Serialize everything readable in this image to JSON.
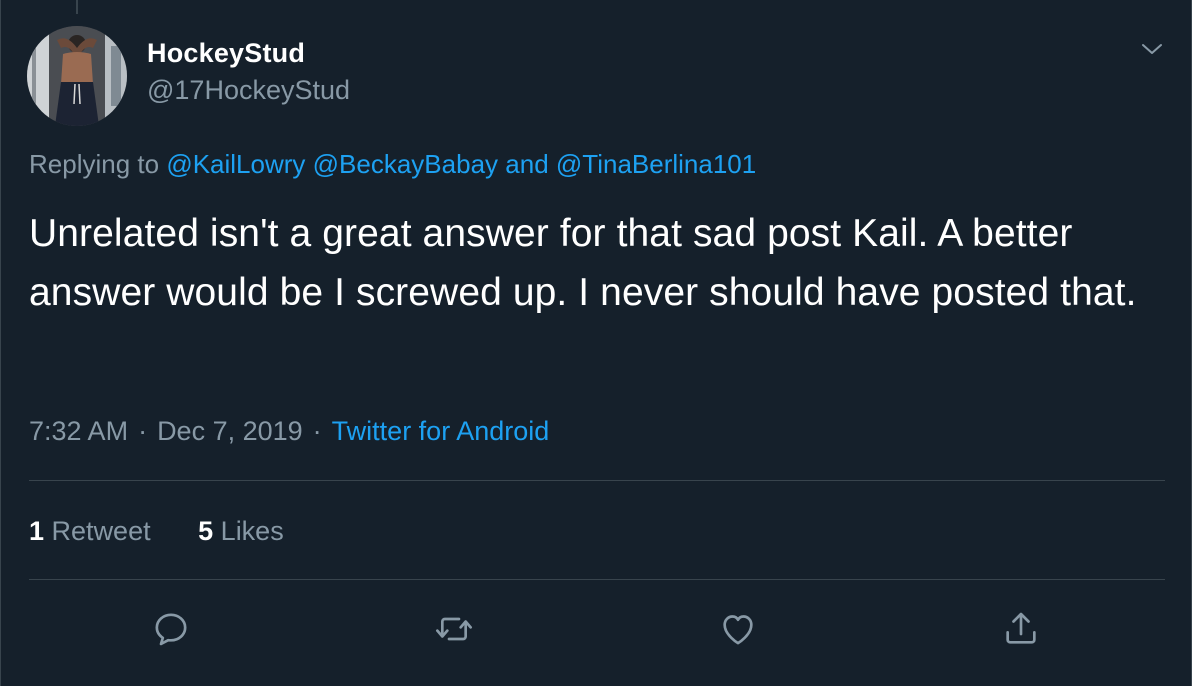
{
  "author": {
    "display_name": "HockeyStud",
    "handle": "@17HockeyStud"
  },
  "reply": {
    "prefix": "Replying to",
    "mention_1": "@KailLowry",
    "mention_2": "@BeckayBabay",
    "conjunction": "and",
    "mention_3": "@TinaBerlina101"
  },
  "tweet": {
    "text": "Unrelated isn't a great answer for that sad post Kail. A better answer would be I screwed up. I never should have posted that."
  },
  "meta": {
    "time": "7:32 AM",
    "separator": "·",
    "date": "Dec 7, 2019",
    "source": "Twitter for Android"
  },
  "stats": {
    "retweets_count": "1",
    "retweets_label": "Retweet",
    "likes_count": "5",
    "likes_label": "Likes"
  },
  "actions": {
    "reply": "reply-icon",
    "retweet": "retweet-icon",
    "like": "heart-icon",
    "share": "share-icon"
  },
  "colors": {
    "background": "#15202b",
    "text": "#ffffff",
    "muted": "#8899a6",
    "link": "#1da1f2",
    "border": "#38444d"
  }
}
